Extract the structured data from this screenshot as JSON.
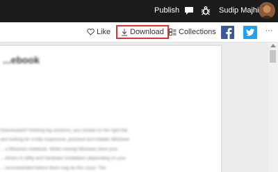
{
  "topbar": {
    "publish_label": "Publish",
    "username": "Sudip Majhi"
  },
  "toolbar": {
    "like_label": "Like",
    "download_label": "Download",
    "collections_label": "Collections",
    "more_label": "···"
  },
  "article": {
    "blurred_title": "...ebook",
    "blurred_lines": [
      "Downloaded? Nothing big solutions, you clicked on the right link",
      "and looking for a fully responsive, practical and reliable Windows",
      "... a Windows notebook. While running Windows drive your",
      "... drivers & utility and hardware installation (depending on your",
      "... recommended before there may be this issue. The"
    ]
  },
  "colors": {
    "topbar_bg": "#1b1b1b",
    "download_highlight": "#e0342a",
    "facebook": "#3b5998",
    "twitter": "#1da1f2"
  }
}
